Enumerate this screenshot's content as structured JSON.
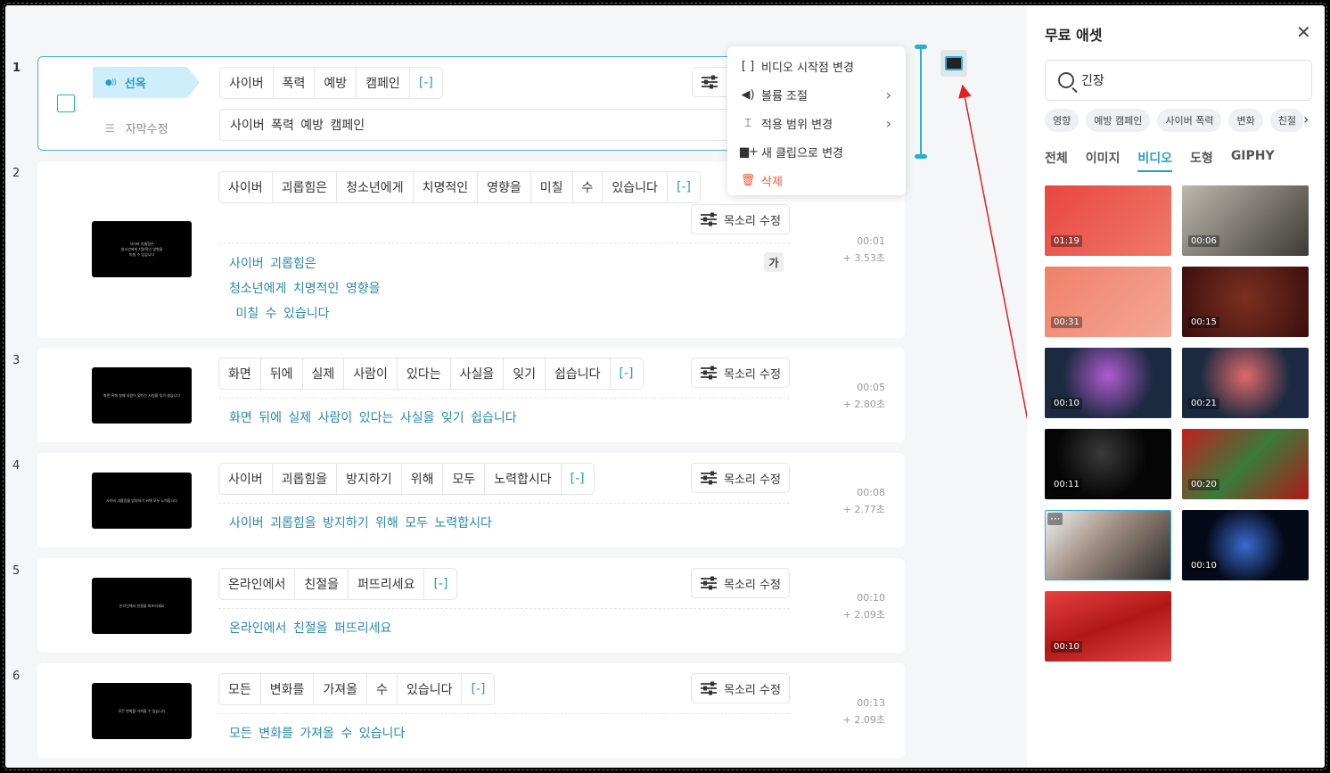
{
  "rows": [
    {
      "num": "1",
      "speaker": "선옥",
      "edit_caption": "자막수정",
      "words": [
        "사이버",
        "폭력",
        "예방",
        "캠페인",
        "[-]"
      ],
      "input_value": "사이버 폭력 예방 캠페인"
    },
    {
      "num": "2",
      "thumb_text": "사이버 괴롭힘은\n청소년에게 치명적인 영향을\n미칠 수 있습니다",
      "words": [
        "사이버",
        "괴롭힘은",
        "청소년에게",
        "치명적인",
        "영향을",
        "미칠",
        "수",
        "있습니다",
        "[-]"
      ],
      "voice": "목소리 수정",
      "subs": [
        "사이버 괴롭힘은",
        "청소년에게 치명적인 영향을",
        " 미칠 수 있습니다"
      ],
      "font_badge": "가",
      "time": "00:01",
      "duration": "+ 3.53초"
    },
    {
      "num": "3",
      "thumb_text": "화면 뒤에 실제 사람이 있다는 사실을 잊기 쉽습니다",
      "words": [
        "화면",
        "뒤에",
        "실제",
        "사람이",
        "있다는",
        "사실을",
        "잊기",
        "쉽습니다",
        "[-]"
      ],
      "voice": "목소리 수정",
      "subs": [
        "화면 뒤에 실제 사람이 있다는 사실을 잊기 쉽습니다"
      ],
      "time": "00:05",
      "duration": "+ 2.80초"
    },
    {
      "num": "4",
      "thumb_text": "사이버 괴롭힘을 방지하기 위해 모두 노력합시다",
      "words": [
        "사이버",
        "괴롭힘을",
        "방지하기",
        "위해",
        "모두",
        "노력합시다",
        "[-]"
      ],
      "voice": "목소리 수정",
      "subs": [
        "사이버 괴롭힘을 방지하기 위해 모두 노력합시다"
      ],
      "time": "00:08",
      "duration": "+ 2.77초"
    },
    {
      "num": "5",
      "thumb_text": "온라인에서 친절을 퍼뜨리세요",
      "words": [
        "온라인에서",
        "친절을",
        "퍼뜨리세요",
        "[-]"
      ],
      "voice": "목소리 수정",
      "subs": [
        "온라인에서 친절을 퍼뜨리세요"
      ],
      "time": "00:10",
      "duration": "+ 2.09초"
    },
    {
      "num": "6",
      "thumb_text": "모든 변화를 가져올 수 있습니다",
      "words": [
        "모든",
        "변화를",
        "가져올",
        "수",
        "있습니다",
        "[-]"
      ],
      "voice": "목소리 수정",
      "subs": [
        "모든 변화를 가져올 수 있습니다"
      ],
      "time": "00:13",
      "duration": "+ 2.09초"
    }
  ],
  "context_menu": [
    {
      "label": "비디오 시작점 변경",
      "icon": "bracket-icon",
      "glyph": "[ ]",
      "submenu": false,
      "danger": false
    },
    {
      "label": "볼륨 조절",
      "icon": "volume-icon",
      "glyph": "◀)",
      "submenu": true,
      "danger": false
    },
    {
      "label": "적용 범위 변경",
      "icon": "range-icon",
      "glyph": "⌶",
      "submenu": true,
      "danger": false
    },
    {
      "label": "새 클립으로 변경",
      "icon": "new-clip-icon",
      "glyph": "▆+",
      "submenu": false,
      "danger": false
    },
    {
      "label": "삭제",
      "icon": "trash-icon",
      "glyph": "🗑",
      "submenu": false,
      "danger": true
    }
  ],
  "panel": {
    "title": "무료 애셋",
    "search_value": "긴장",
    "tags": [
      "영향",
      "예방 캠페인",
      "사이버 폭력",
      "변화",
      "친절"
    ],
    "tabs": [
      "전체",
      "이미지",
      "비디오",
      "도형",
      "GIPHY"
    ],
    "active_tab": "비디오",
    "videos": [
      {
        "duration": "01:19",
        "bg": "linear-gradient(135deg,#e8463f,#f07a6a)"
      },
      {
        "duration": "00:06",
        "bg": "linear-gradient(135deg,#bdb8ad,#3d3a35)"
      },
      {
        "duration": "00:31",
        "bg": "linear-gradient(135deg,#f0806a,#f4a896)"
      },
      {
        "duration": "00:15",
        "bg": "radial-gradient(circle at 50% 45%,#7a3020,#3a0e0e)"
      },
      {
        "duration": "00:10",
        "bg": "radial-gradient(circle at 50% 40%,#b05cd0,#1b2a40 60%)"
      },
      {
        "duration": "00:21",
        "bg": "radial-gradient(circle at 50% 40%,#e06a6a,#1b2a40 60%)"
      },
      {
        "duration": "00:11",
        "bg": "radial-gradient(circle at 45% 35%,#3a3a3a,#050505 55%)"
      },
      {
        "duration": "00:20",
        "bg": "linear-gradient(135deg,#c02020,#3a7a3a 50%,#b01818)"
      },
      {
        "duration": "",
        "bg": "linear-gradient(135deg,#f2f2f2,#9c8a7e 45%,#2a2a2a)"
      },
      {
        "duration": "00:10",
        "bg": "radial-gradient(circle at 50% 50%,#3a6bd0,#050a18 55%)"
      },
      {
        "duration": "00:10",
        "bg": "linear-gradient(160deg,#e84040,#b01818 50%,#e04848)"
      }
    ]
  }
}
